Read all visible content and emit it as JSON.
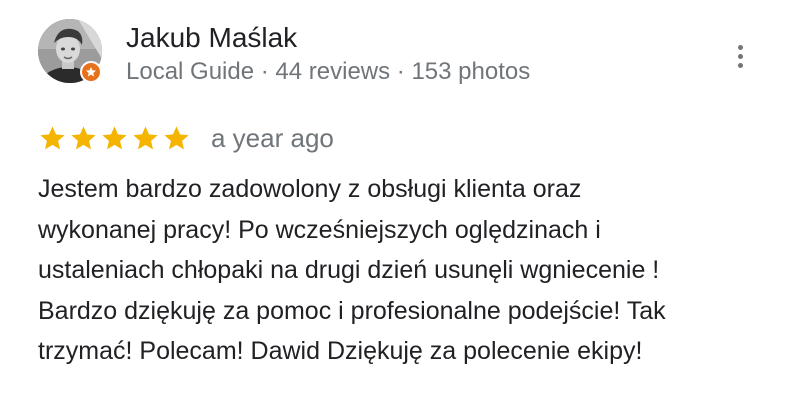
{
  "review": {
    "author": {
      "name": "Jakub Maślak",
      "meta": "Local Guide · 44 reviews · 153 photos"
    },
    "rating": {
      "stars": 5,
      "max": 5,
      "star_color": "#f4b400"
    },
    "date": "a year ago",
    "text_lines": [
      "Jestem bardzo zadowolony z obsługi klienta oraz",
      "wykonanej pracy! Po wcześniejszych oględzinach i",
      "ustaleniach chłopaki na drugi dzień usunęli wgniecenie !",
      "Bardzo dziękuję za pomoc i profesionalne podejście! Tak",
      "trzymać! Polecam! Dawid Dziękuję za polecenie ekipy!"
    ],
    "icons": {
      "menu": "more-vert-icon",
      "badge": "local-guide-star-icon",
      "star": "star-icon"
    },
    "colors": {
      "badge": "#e8711c",
      "secondary_text": "#70757a",
      "primary_text": "#202124"
    }
  }
}
